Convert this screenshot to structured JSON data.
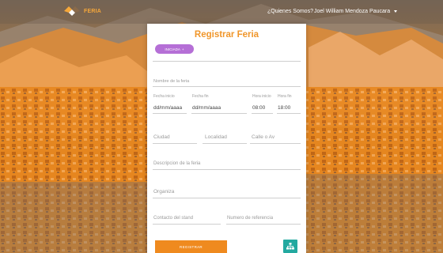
{
  "navbar": {
    "brand": "FERIA",
    "about_link": "¿Quienes Somos?",
    "user_name": "Joel William Mendoza Paucara"
  },
  "form": {
    "title": "Registrar Feria",
    "dropdown_button": "INICIADA",
    "feria_name_label": "Nombre de la feria",
    "start_date_label": "Fecha inicio",
    "end_date_label": "Fecha fin",
    "start_time_label": "Hora inicio",
    "end_time_label": "Hora fin",
    "start_date_value": "dd/mm/aaaa",
    "end_date_value": "dd/mm/aaaa",
    "start_time_value": "08:00",
    "end_time_value": "18:00",
    "city_placeholder": "Ciudad",
    "locality_placeholder": "Localidad",
    "street_placeholder": "Calle o Av",
    "description_label": "Descripcion de la feria",
    "organizer_placeholder": "Organiza",
    "contact_placeholder": "Contacto del stand",
    "reference_placeholder": "Numero de referencia",
    "submit_button": "REGISTRAR"
  },
  "colors": {
    "accent_orange": "#ef8a1f",
    "title_orange": "#f0962a",
    "purple_button": "#b56fd6",
    "teal_button": "#23a9a0"
  },
  "icons": {
    "brand_logo": "diamond-logo-icon",
    "user_caret": "chevron-down-icon",
    "map_button": "sitemap-icon"
  }
}
